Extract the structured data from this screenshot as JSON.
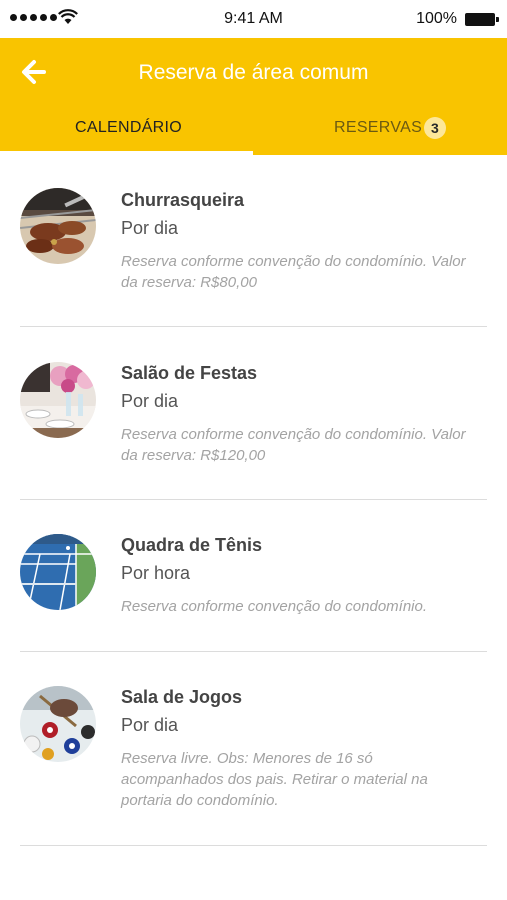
{
  "status_bar": {
    "time": "9:41 AM",
    "battery_percent": "100%"
  },
  "header": {
    "title": "Reserva de área comum",
    "back_icon": "arrow-left-icon",
    "background": "#f9c400"
  },
  "tabs": [
    {
      "label": "CALENDÁRIO",
      "active": true
    },
    {
      "label": "RESERVAS",
      "badge": "3",
      "active": false
    }
  ],
  "areas": [
    {
      "name": "Churrasqueira",
      "period": "Por dia",
      "description": "Reserva conforme convenção do condomínio. Valor da reserva: R$80,00",
      "image": "barbecue-grill"
    },
    {
      "name": "Salão de Festas",
      "period": "Por dia",
      "description": "Reserva conforme convenção do condomínio. Valor da reserva: R$120,00",
      "image": "party-hall-table"
    },
    {
      "name": "Quadra de Tênis",
      "period": "Por hora",
      "description": "Reserva conforme convenção do condomínio.",
      "image": "tennis-court"
    },
    {
      "name": "Sala de Jogos",
      "period": "Por dia",
      "description": "Reserva livre. Obs: Menores de 16 só acompanhados dos pais. Retirar o material na portaria do condomínio.",
      "image": "billiard-table"
    }
  ]
}
